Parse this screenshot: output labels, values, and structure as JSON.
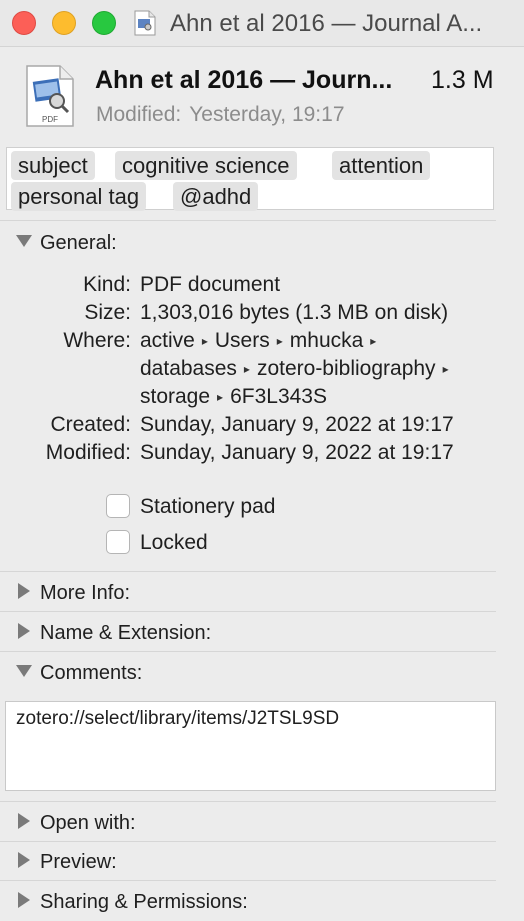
{
  "window": {
    "title": "Ahn et al 2016 — Journal A...",
    "traffic_lights": {
      "close": "#fc5f57",
      "minimize": "#fdbc2e",
      "zoom": "#28c840"
    }
  },
  "header": {
    "file_name": "Ahn et al 2016 — Journ...",
    "file_size": "1.3 M",
    "modified_label": "Modified:",
    "modified_value": "Yesterday, 19:17",
    "file_icon_label": "PDF"
  },
  "tags": [
    "subject",
    "cognitive science",
    "attention",
    "personal tag",
    "@adhd"
  ],
  "general": {
    "label": "General:",
    "kind_label": "Kind:",
    "kind_value": "PDF document",
    "size_label": "Size:",
    "size_value": "1,303,016 bytes (1.3 MB on disk)",
    "where_label": "Where:",
    "where_path": [
      "active",
      "Users",
      "mhucka",
      "databases",
      "zotero-bibliography",
      "storage",
      "6F3L343S"
    ],
    "path_separator": "▸",
    "created_label": "Created:",
    "created_value": "Sunday, January 9, 2022 at 19:17",
    "modified_label": "Modified:",
    "modified_value": "Sunday, January 9, 2022 at 19:17",
    "stationery_label": "Stationery pad",
    "locked_label": "Locked"
  },
  "sections": {
    "more_info": "More Info:",
    "name_ext": "Name & Extension:",
    "comments": "Comments:",
    "open_with": "Open with:",
    "preview": "Preview:",
    "sharing": "Sharing & Permissions:"
  },
  "comments_text": "zotero://select/library/items/J2TSL9SD"
}
